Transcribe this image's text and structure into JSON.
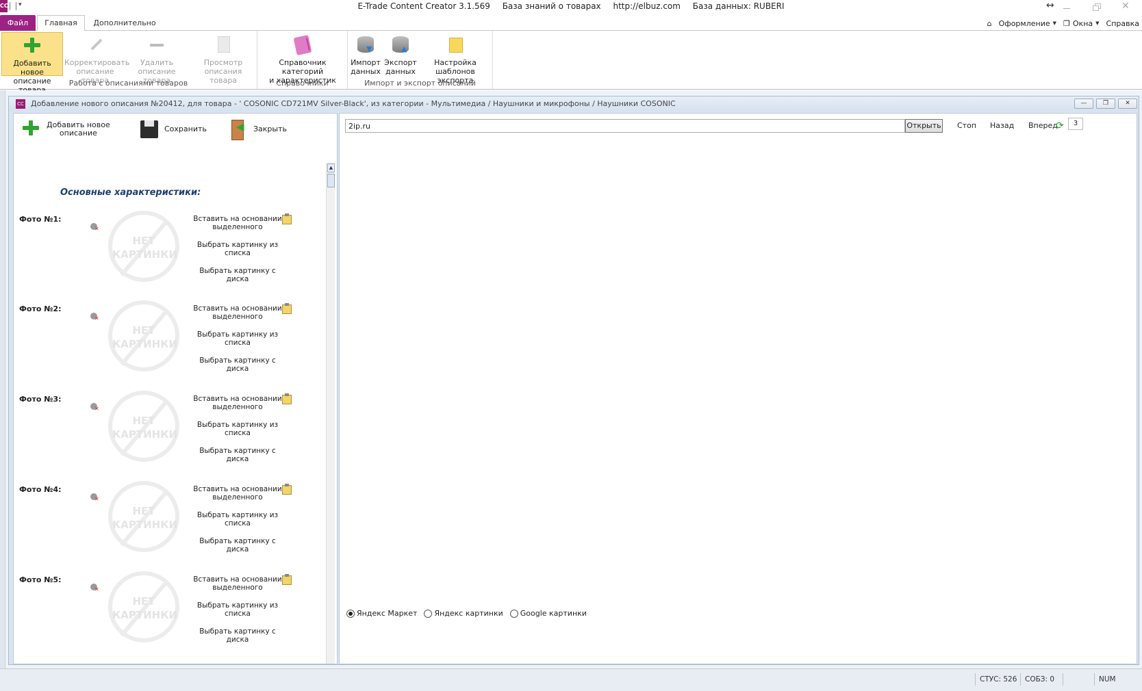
{
  "app": {
    "logo": "CC",
    "title_parts": [
      "E-Trade Content Creator 3.1.569",
      "База знаний о товарах",
      "http://elbuz.com",
      "База данных: RUBERI"
    ]
  },
  "ribbon_tabs": {
    "file": "Файл",
    "home": "Главная",
    "extra": "Дополнительно"
  },
  "ribbon_right": {
    "design": "Оформление",
    "windows": "Окна",
    "help": "Справка"
  },
  "ribbon": {
    "group1": {
      "label": "Работа с описаниями товаров",
      "add": [
        "Добавить новое",
        "описание товара"
      ],
      "edit": [
        "Корректировать",
        "описание товара"
      ],
      "delete": [
        "Удалить",
        "описание товара"
      ],
      "view": [
        "Просмотр",
        "описания товара"
      ]
    },
    "group2": {
      "label": "Справочники",
      "catalog": [
        "Справочник категорий",
        "и характеристик"
      ]
    },
    "group3": {
      "label": "Импорт и экспорт описаний",
      "import": [
        "Импорт",
        "данных"
      ],
      "export": [
        "Экспорт",
        "данных"
      ],
      "templates": [
        "Настройка",
        "шаблонов экспорта"
      ]
    }
  },
  "doc_window": {
    "icon": "CC",
    "title": "Добавление нового описания №20412, для товара - '  COSONIC CD721MV Silver-Black', из категории - Мультимедиа / Наушники и микрофоны / Наушники COSONIC",
    "buttons": {
      "minimize": "—",
      "restore": "❐",
      "close": "✕"
    }
  },
  "left_toolbar": {
    "add": [
      "Добавить новое",
      "описание"
    ],
    "save": "Сохранить",
    "close": "Закрыть"
  },
  "section_title": "Основные характеристики:",
  "photos": [
    {
      "label": "Фото №1:"
    },
    {
      "label": "Фото №2:"
    },
    {
      "label": "Фото №3:"
    },
    {
      "label": "Фото №4:"
    },
    {
      "label": "Фото №5:"
    }
  ],
  "photo_placeholder": [
    "НЕТ",
    "КАРТИНКИ"
  ],
  "photo_actions": {
    "paste": [
      "Вставить на основании",
      "выделенного"
    ],
    "from_list": [
      "Выбрать картинку из",
      "списка"
    ],
    "from_disk": [
      "Выбрать картинку с",
      "диска"
    ]
  },
  "browser": {
    "url": "2ip.ru",
    "open": "Открыть",
    "stop": "Стоп",
    "back": "Назад",
    "forward": "Вперед",
    "counter": "3",
    "search_sources": [
      {
        "label": "Яндекс Маркет",
        "checked": true
      },
      {
        "label": "Яндекс картинки",
        "checked": false
      },
      {
        "label": "Google картинки",
        "checked": false
      }
    ]
  },
  "statusbar": {
    "stus": "СТУС: 526",
    "sobz": "СОБЗ: 0",
    "num": "NUM"
  },
  "icons": {
    "add": "plus-icon",
    "edit": "pencil-icon",
    "delete": "minus-icon",
    "view": "document-icon",
    "catalog": "book-icon",
    "import": "database-import-icon",
    "export": "database-export-icon",
    "templates": "note-icon",
    "save": "floppy-icon",
    "close": "door-exit-icon",
    "refresh": "refresh-icon"
  },
  "colors": {
    "accent": "#9b2384",
    "active_button": "#fbe28a",
    "section_title": "#1f3f6f"
  }
}
